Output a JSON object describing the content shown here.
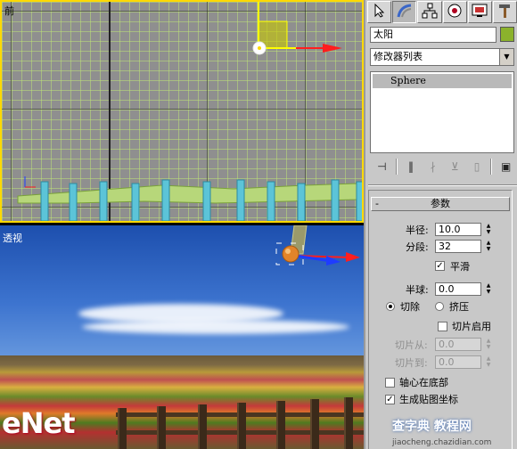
{
  "viewports": {
    "front_label": "前",
    "persp_label": "透视"
  },
  "panel": {
    "tabs": [
      {
        "name": "create-tab",
        "icon": "arrow-cursor-icon"
      },
      {
        "name": "modify-tab",
        "icon": "curve-icon"
      },
      {
        "name": "hierarchy-tab",
        "icon": "hierarchy-icon"
      },
      {
        "name": "motion-tab",
        "icon": "motion-icon"
      },
      {
        "name": "display-tab",
        "icon": "display-icon"
      },
      {
        "name": "utilities-tab",
        "icon": "hammer-icon"
      }
    ],
    "object_name": "太阳",
    "object_color": "#8bb22c",
    "modifier_list": "修改器列表",
    "stack_item": "Sphere",
    "rollout_title": "参数",
    "params": {
      "radius_label": "半径:",
      "radius_value": "10.0",
      "segments_label": "分段:",
      "segments_value": "32",
      "smooth_label": "平滑",
      "hemisphere_label": "半球:",
      "hemisphere_value": "0.0",
      "chop_label": "切除",
      "squash_label": "挤压",
      "slice_on_label": "切片启用",
      "slice_from_label": "切片从:",
      "slice_from_value": "0.0",
      "slice_to_label": "切片到:",
      "slice_to_value": "0.0",
      "base_to_pivot_label": "轴心在底部",
      "gen_mapping_label": "生成贴图坐标"
    }
  },
  "watermark": {
    "text": "查字典 教程网",
    "url": "jiaocheng.chazidian.com",
    "logo": "eNet"
  }
}
